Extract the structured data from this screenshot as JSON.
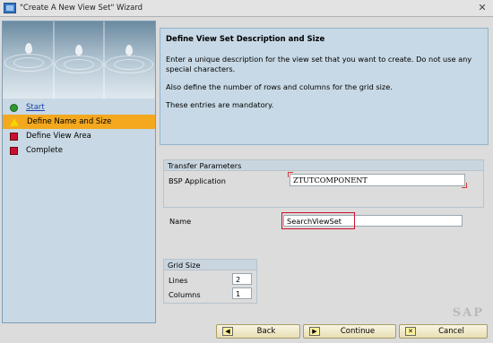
{
  "window": {
    "title": "\"Create A New View Set\" Wizard",
    "close_glyph": "✕"
  },
  "steps": [
    {
      "label": "Start",
      "icon": "green-dot-icon",
      "state": "done"
    },
    {
      "label": "Define Name and Size",
      "icon": "warning-triangle-icon",
      "state": "active"
    },
    {
      "label": "Define View Area",
      "icon": "red-square-icon",
      "state": "pending"
    },
    {
      "label": "Complete",
      "icon": "red-square-icon",
      "state": "pending"
    }
  ],
  "header": {
    "title": "Define View Set Description and Size",
    "paragraphs": [
      "Enter a unique description for the view set that you want to create. Do not use any special characters.",
      "Also define the number of rows and columns for the grid size.",
      "These entries are mandatory."
    ]
  },
  "transfer": {
    "title": "Transfer Parameters",
    "bsp_label": "BSP Application",
    "bsp_value": "ZTUTCOMPONENT"
  },
  "name": {
    "label": "Name",
    "value": "SearchViewSet"
  },
  "grid": {
    "title": "Grid Size",
    "lines_label": "Lines",
    "lines_value": "2",
    "columns_label": "Columns",
    "columns_value": "1"
  },
  "buttons": {
    "back": {
      "label": "Back",
      "icon_glyph": "◀"
    },
    "continue": {
      "label": "Continue",
      "icon_glyph": "▶"
    },
    "cancel": {
      "label": "Cancel",
      "icon_glyph": "✕"
    }
  },
  "watermark": "SAP"
}
